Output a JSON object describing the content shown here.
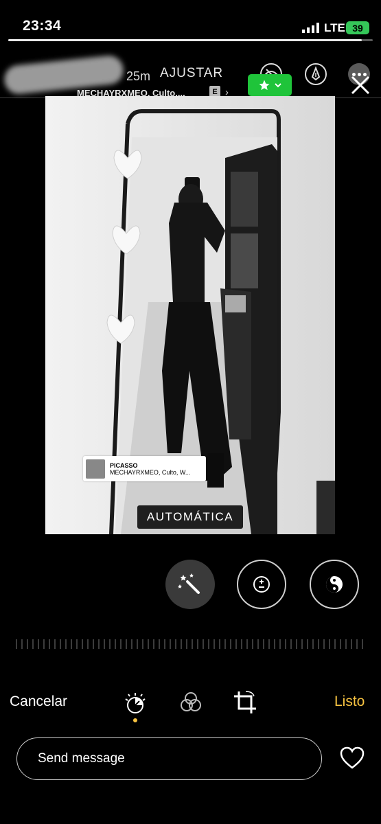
{
  "status_bar": {
    "time": "23:34",
    "network": "LTE",
    "battery": "39"
  },
  "story": {
    "progress": 0.97,
    "time_ago": "25m",
    "mode_title": "AJUSTAR"
  },
  "music": {
    "header_text": "MECHAYRXMEO, Culto,...",
    "explicit_badge": "E",
    "chevron": "›",
    "sticker_title": "PICASSO",
    "sticker_artist": "MECHAYRXMEO, Culto, W..."
  },
  "header_icons": [
    "close-friends-star-icon",
    "chevron-down-icon",
    "eye-off-icon",
    "pen-icon",
    "more-icon",
    "close-icon"
  ],
  "photo": {
    "effect_label": "AUTOMÁTICA"
  },
  "tools": [
    "magic-wand-icon",
    "exposure-icon",
    "contrast-icon"
  ],
  "toolbar": {
    "cancel_label": "Cancelar",
    "done_label": "Listo"
  },
  "tabs": [
    "adjust-dial-icon",
    "filters-icon",
    "crop-rotate-icon"
  ],
  "message": {
    "placeholder": "Send message"
  },
  "colors": {
    "done": "#f7c341",
    "close_friends": "#1fc43a",
    "battery": "#35c759"
  }
}
